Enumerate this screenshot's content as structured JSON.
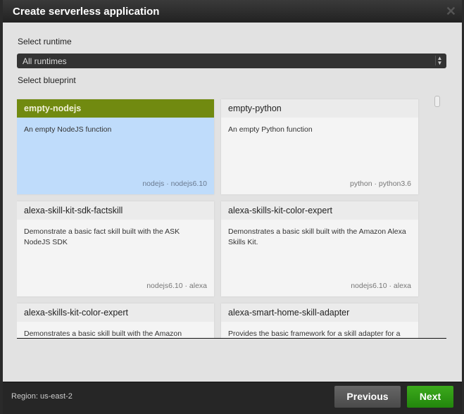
{
  "title": "Create serverless application",
  "runtime": {
    "label": "Select runtime",
    "value": "All runtimes"
  },
  "blueprint_label": "Select blueprint",
  "cards": [
    {
      "name": "empty-nodejs",
      "desc": "An empty NodeJS function",
      "tags": "nodejs · nodejs6.10",
      "selected": true
    },
    {
      "name": "empty-python",
      "desc": "An empty Python function",
      "tags": "python · python3.6"
    },
    {
      "name": "alexa-skill-kit-sdk-factskill",
      "desc": "Demonstrate a basic fact skill built with the ASK NodeJS SDK",
      "tags": "nodejs6.10 · alexa"
    },
    {
      "name": "alexa-skills-kit-color-expert",
      "desc": "Demonstrates a basic skill built with the Amazon Alexa Skills Kit.",
      "tags": "nodejs6.10 · alexa"
    },
    {
      "name": "alexa-skills-kit-color-expert",
      "desc": "Demonstrates a basic skill built with the Amazon",
      "tags": ""
    },
    {
      "name": "alexa-smart-home-skill-adapter",
      "desc": "Provides the basic framework for a skill adapter for a",
      "tags": ""
    }
  ],
  "footer": {
    "region": "Region: us-east-2",
    "previous": "Previous",
    "next": "Next"
  }
}
